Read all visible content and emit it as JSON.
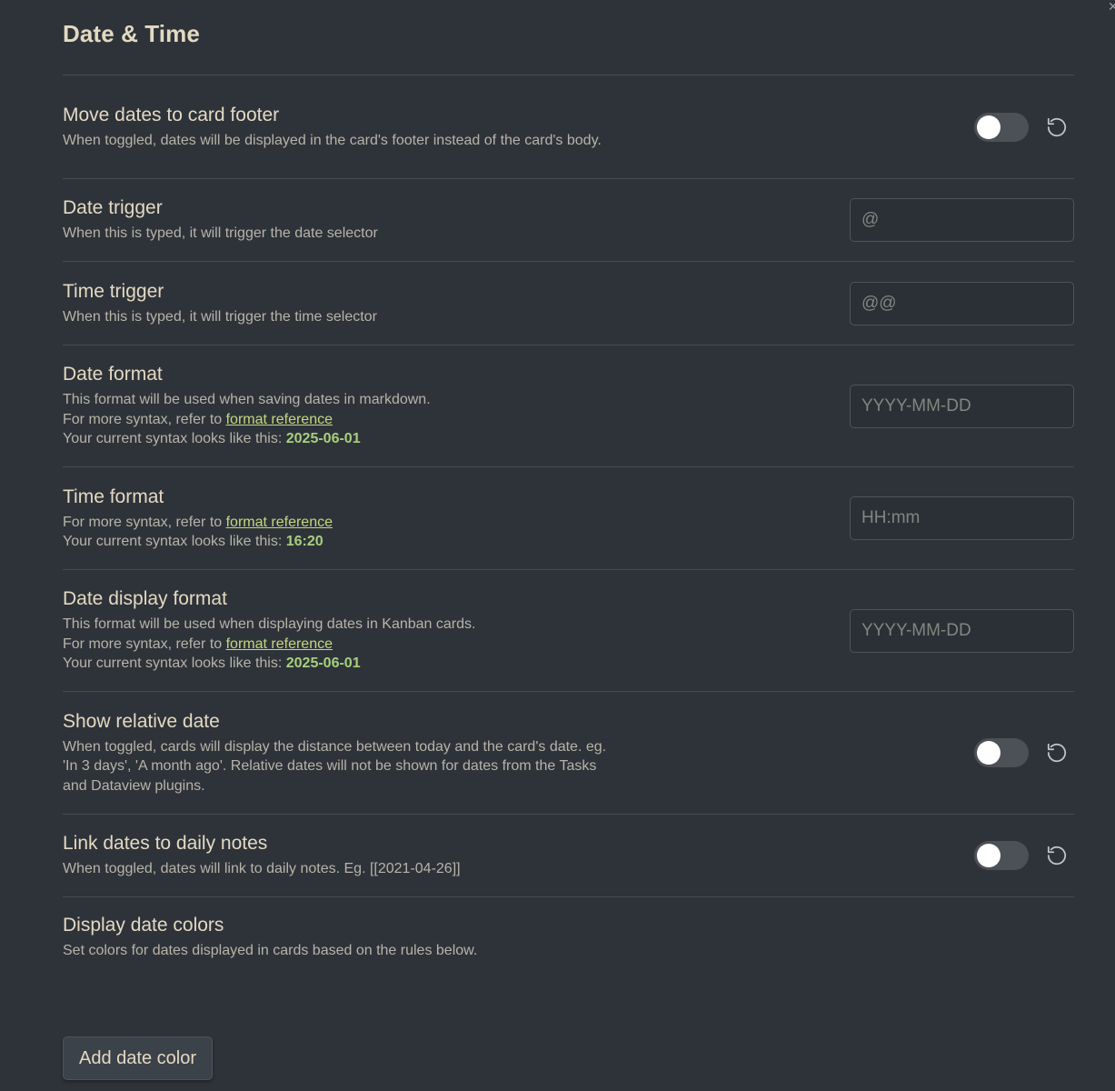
{
  "section_title": "Date & Time",
  "settings": {
    "move_dates": {
      "name": "Move dates to card footer",
      "desc": "When toggled, dates will be displayed in the card's footer instead of the card's body.",
      "enabled": false
    },
    "date_trigger": {
      "name": "Date trigger",
      "desc": "When this is typed, it will trigger the date selector",
      "placeholder": "@"
    },
    "time_trigger": {
      "name": "Time trigger",
      "desc": "When this is typed, it will trigger the time selector",
      "placeholder": "@@"
    },
    "date_format": {
      "name": "Date format",
      "desc_line1": "This format will be used when saving dates in markdown.",
      "ref_prefix": "For more syntax, refer to ",
      "ref_link": "format reference",
      "preview_prefix": "Your current syntax looks like this: ",
      "preview_value": "2025-06-01",
      "placeholder": "YYYY-MM-DD"
    },
    "time_format": {
      "name": "Time format",
      "ref_prefix": "For more syntax, refer to ",
      "ref_link": "format reference",
      "preview_prefix": "Your current syntax looks like this: ",
      "preview_value": "16:20",
      "placeholder": "HH:mm"
    },
    "date_display_format": {
      "name": "Date display format",
      "desc_line1": "This format will be used when displaying dates in Kanban cards.",
      "ref_prefix": "For more syntax, refer to ",
      "ref_link": "format reference",
      "preview_prefix": "Your current syntax looks like this: ",
      "preview_value": "2025-06-01",
      "placeholder": "YYYY-MM-DD"
    },
    "relative_date": {
      "name": "Show relative date",
      "desc": "When toggled, cards will display the distance between today and the card's date. eg. 'In 3 days', 'A month ago'. Relative dates will not be shown for dates from the Tasks and Dataview plugins.",
      "enabled": false
    },
    "link_daily_notes": {
      "name": "Link dates to daily notes",
      "desc": "When toggled, dates will link to daily notes. Eg. [[2021-04-26]]",
      "enabled": false
    },
    "date_colors": {
      "name": "Display date colors",
      "desc": "Set colors for dates displayed in cards based on the rules below."
    }
  },
  "add_date_color_button": "Add date color",
  "icons": {
    "reset": "reset-icon",
    "close": "close-icon"
  }
}
